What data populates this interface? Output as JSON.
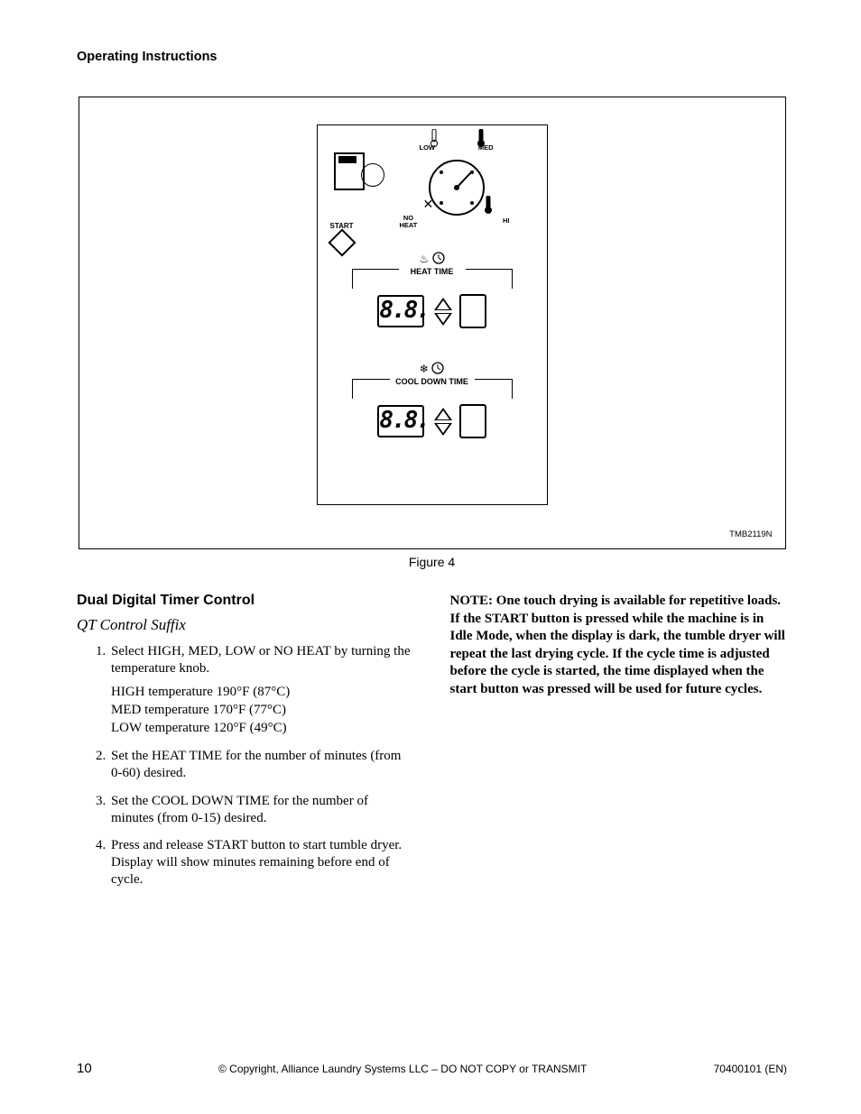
{
  "header": "Operating Instructions",
  "figure": {
    "id": "TMB2119N",
    "caption": "Figure 4",
    "panel": {
      "temp_labels": {
        "low": "LOW",
        "med": "MED",
        "noheat_l1": "NO",
        "noheat_l2": "HEAT",
        "hi": "HI"
      },
      "start_label": "START",
      "section1": {
        "title": "HEAT TIME",
        "display": "8.8."
      },
      "section2": {
        "title": "COOL DOWN TIME",
        "display": "8.8."
      }
    }
  },
  "left": {
    "heading": "Dual Digital Timer Control",
    "subheading": "QT Control Suffix",
    "steps": [
      {
        "text": "Select HIGH, MED, LOW or NO HEAT by turning the temperature knob.",
        "sub": [
          "HIGH temperature 190°F (87°C)",
          "MED temperature  170°F (77°C)",
          "LOW temperature  120°F (49°C)"
        ]
      },
      {
        "text": "Set the HEAT TIME for the number of minutes (from 0-60) desired."
      },
      {
        "text": "Set the COOL DOWN TIME for the number of minutes (from 0-15) desired."
      },
      {
        "text": "Press and release START button to start tumble dryer. Display will show minutes remaining before end of cycle."
      }
    ]
  },
  "right": {
    "note": "NOTE: One touch drying is available for repetitive loads. If the START button is pressed while the machine is in Idle Mode, when the display is dark, the tumble dryer will repeat the last drying cycle. If the cycle time is adjusted before the cycle is started, the time displayed when the start button was pressed will be used for future cycles."
  },
  "footer": {
    "page": "10",
    "copyright": "© Copyright, Alliance Laundry Systems LLC – DO NOT COPY or TRANSMIT",
    "docnum": "70400101 (EN)"
  }
}
